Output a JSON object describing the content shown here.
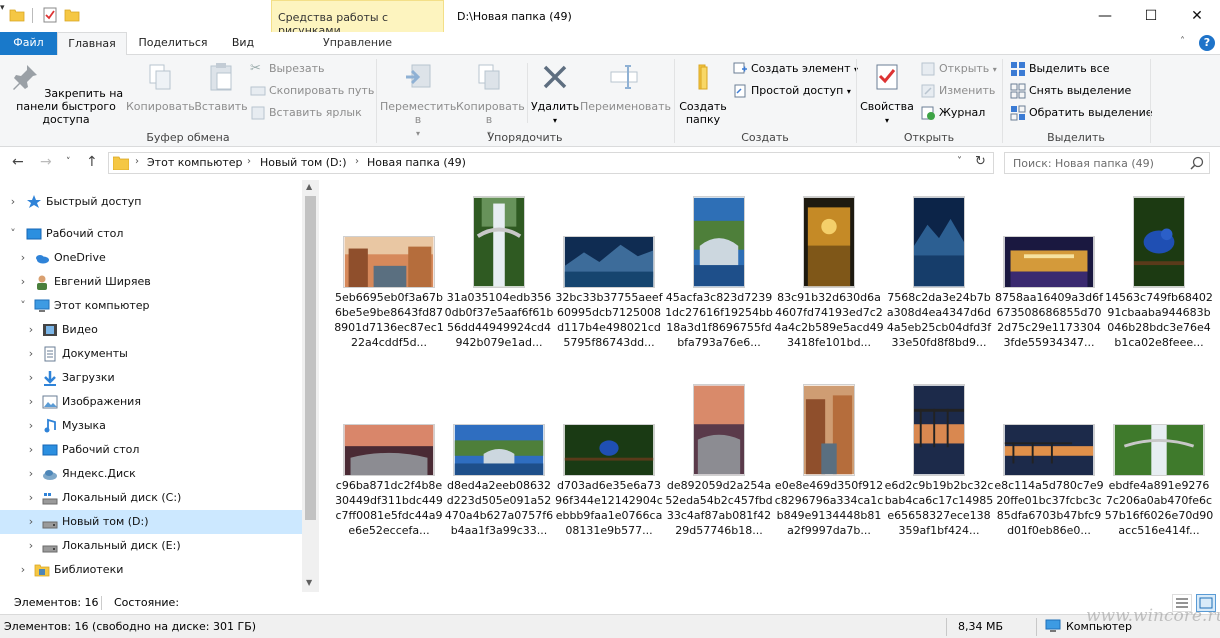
{
  "titlebar": {
    "context_tab": "Средства работы с рисунками",
    "title": "D:\\Новая папка (49)",
    "minimize": "—",
    "maximize": "☐",
    "close": "✕"
  },
  "tabs": {
    "file": "Файл",
    "home": "Главная",
    "share": "Поделиться",
    "view": "Вид",
    "manage": "Управление"
  },
  "ribbon": {
    "clipboard": {
      "label": "Буфер обмена",
      "pin": "Закрепить на панели быстрого доступа",
      "copy": "Копировать",
      "paste": "Вставить",
      "cut": "Вырезать",
      "copy_path": "Скопировать путь",
      "paste_shortcut": "Вставить ярлык"
    },
    "organize": {
      "label": "Упорядочить",
      "move_to": "Переместить в",
      "copy_to": "Копировать в",
      "delete": "Удалить",
      "rename": "Переименовать"
    },
    "new": {
      "label": "Создать",
      "new_folder": "Создать папку",
      "new_item": "Создать элемент",
      "easy_access": "Простой доступ"
    },
    "open": {
      "label": "Открыть",
      "properties": "Свойства",
      "open": "Открыть",
      "edit": "Изменить",
      "history": "Журнал"
    },
    "select": {
      "label": "Выделить",
      "select_all": "Выделить все",
      "select_none": "Снять выделение",
      "invert": "Обратить выделение"
    }
  },
  "address": {
    "crumbs": [
      "Этот компьютер",
      "Новый том (D:)",
      "Новая папка (49)"
    ],
    "search_placeholder": "Поиск: Новая папка (49)"
  },
  "nav_tree": [
    {
      "label": "Быстрый доступ",
      "icon": "star-icon"
    },
    {
      "label": "Рабочий стол",
      "icon": "desktop-icon"
    },
    {
      "label": "OneDrive",
      "icon": "onedrive-icon"
    },
    {
      "label": "Евгений Ширяев",
      "icon": "user-icon"
    },
    {
      "label": "Этот компьютер",
      "icon": "computer-icon"
    },
    {
      "label": "Видео",
      "icon": "video-icon"
    },
    {
      "label": "Документы",
      "icon": "documents-icon"
    },
    {
      "label": "Загрузки",
      "icon": "downloads-icon"
    },
    {
      "label": "Изображения",
      "icon": "pictures-icon"
    },
    {
      "label": "Музыка",
      "icon": "music-icon"
    },
    {
      "label": "Рабочий стол",
      "icon": "desktop-icon"
    },
    {
      "label": "Яндекс.Диск",
      "icon": "yandex-disk-icon"
    },
    {
      "label": "Локальный диск (C:)",
      "icon": "drive-c-icon"
    },
    {
      "label": "Новый том (D:)",
      "icon": "drive-icon"
    },
    {
      "label": "Локальный диск (E:)",
      "icon": "drive-icon"
    },
    {
      "label": "Библиотеки",
      "icon": "libraries-icon"
    }
  ],
  "files": [
    {
      "name": "5eb6695eb0f3a67b6be5e9be8643fd878901d7136ec87ec122a4cddf5d..."
    },
    {
      "name": "31a035104edb3560db0f37e5aaf6f61b56dd44949924cd4942b079e1ad..."
    },
    {
      "name": "32bc33b37755aeef60995dcb7125008d117b4e498021cd5795f86743dd..."
    },
    {
      "name": "45acfa3c823d72391dc27616f19254bb18a3d1f8696755fdbfa793a76e6..."
    },
    {
      "name": "83c91b32d630d6a4607fd74193ed7c24a4c2b589e5acd493418fe101bd..."
    },
    {
      "name": "7568c2da3e24b7ba308d4ea4347d6d4a5eb25cb04dfd3f33e50fd8f8bd9..."
    },
    {
      "name": "8758aa16409a3d6f673508686855d702d75c29e11733043fde55934347..."
    },
    {
      "name": "14563c749fb6840291cbaaba944683b046b28bdc3e76e4b1ca02e8feee..."
    },
    {
      "name": "c96ba871dc2f4b8e30449df311bdc449c7ff0081e5fdc44a9e6e52eccefa..."
    },
    {
      "name": "d8ed4a2eeb08632d223d505e091a52470a4b627a0757f6b4aa1f3a99c33..."
    },
    {
      "name": "d703ad6e35e6a7396f344e12142904cebbb9faa1e0766ca08131e9b577..."
    },
    {
      "name": "de892059d2a254a52eda54b2c457fbd33c4af87ab081f4229d57746b18..."
    },
    {
      "name": "e0e8e469d350f912c8296796a334ca1cb849e9134448b81a2f9997da7b..."
    },
    {
      "name": "e6d2c9b19b2bc32cbab4ca6c17c14985e65658327ece138359af1bf424..."
    },
    {
      "name": "e8c114a5d780c7e920ffe01bc37fcbc3c85dfa6703b47bfc9d01f0eb86e0..."
    },
    {
      "name": "ebdfe4a891e9276 7c206a0ab470fe6c57b16f6026e70d90acc516e414f..."
    }
  ],
  "status": {
    "count": "Элементов: 16",
    "state": "Состояние:",
    "bottom": "Элементов: 16 (свободно на диске: 301 ГБ)",
    "size": "8,34 МБ",
    "location": "Компьютер"
  },
  "watermark": "www.wincore.ru",
  "colors": {
    "accent": "#1979ca",
    "context_tab": "#fdf4bf",
    "selection": "#cce8ff"
  }
}
